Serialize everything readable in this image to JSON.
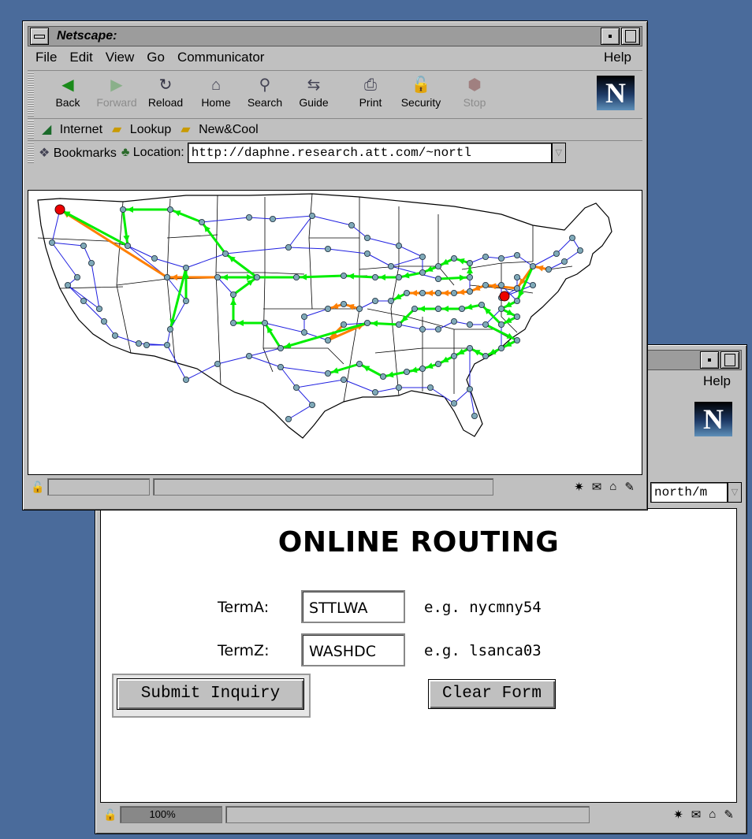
{
  "back_window": {
    "menu_help": "Help",
    "url_partial": "north/m",
    "heading": "ONLINE ROUTING",
    "form": {
      "terma_label": "TermA:",
      "terma_value": "STTLWA",
      "terma_example": "e.g. nycmny54",
      "termz_label": "TermZ:",
      "termz_value": "WASHDC",
      "termz_example": "e.g. lsanca03",
      "submit_label": "Submit Inquiry",
      "clear_label": "Clear Form"
    },
    "status_progress": "100%"
  },
  "front_window": {
    "title": "Netscape:",
    "menu": [
      "File",
      "Edit",
      "View",
      "Go",
      "Communicator"
    ],
    "menu_help": "Help",
    "toolbar": [
      {
        "label": "Back",
        "icon": "back-icon",
        "enabled": true
      },
      {
        "label": "Forward",
        "icon": "forward-icon",
        "enabled": false
      },
      {
        "label": "Reload",
        "icon": "reload-icon",
        "enabled": true
      },
      {
        "label": "Home",
        "icon": "home-icon",
        "enabled": true
      },
      {
        "label": "Search",
        "icon": "search-icon",
        "enabled": true
      },
      {
        "label": "Guide",
        "icon": "guide-icon",
        "enabled": true
      },
      {
        "label": "Print",
        "icon": "print-icon",
        "enabled": true
      },
      {
        "label": "Security",
        "icon": "security-icon",
        "enabled": true
      },
      {
        "label": "Stop",
        "icon": "stop-icon",
        "enabled": false
      }
    ],
    "personal_toolbar": [
      "Internet",
      "Lookup",
      "New&Cool"
    ],
    "bookmarks_label": "Bookmarks",
    "location_label": "Location:",
    "url": "http://daphne.research.att.com/~nortl"
  },
  "colors": {
    "desktop": "#4a6b9b",
    "network_link": "#2020e0",
    "route_primary": "#00ee00",
    "route_alternate": "#ff7f00",
    "node": "#7fa9b8",
    "endpoint": "#ee0000"
  }
}
